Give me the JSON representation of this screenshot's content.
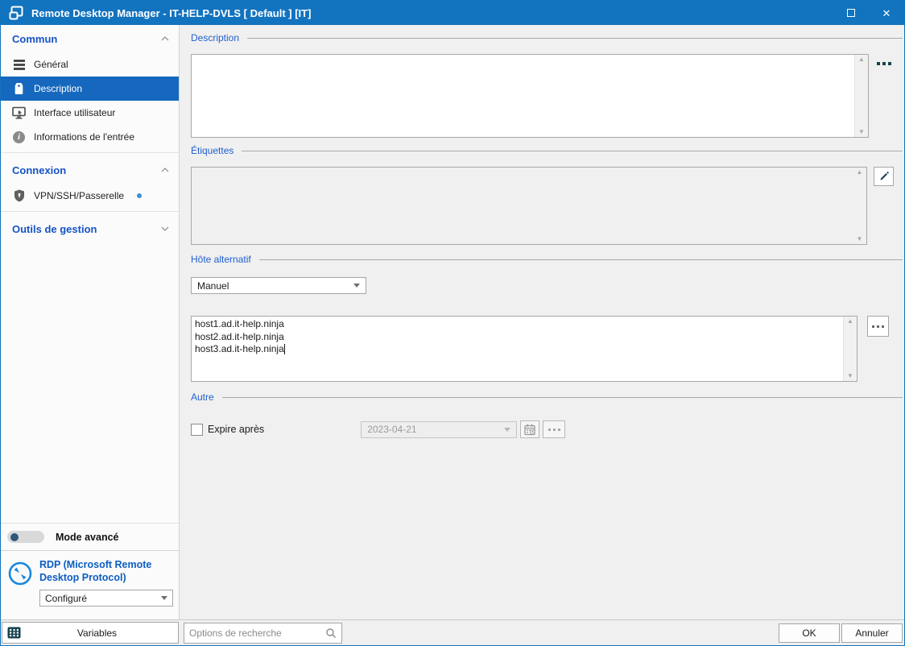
{
  "window": {
    "title": "Remote Desktop Manager - IT-HELP-DVLS [ Default ] [IT]",
    "close_glyph": "✕"
  },
  "sidebar": {
    "sections": [
      {
        "label": "Commun",
        "chevron": "up",
        "items": [
          {
            "label": "Général",
            "icon": "menu-lines-icon"
          },
          {
            "label": "Description",
            "icon": "tag-icon",
            "selected": true
          },
          {
            "label": "Interface utilisateur",
            "icon": "monitor-icon"
          },
          {
            "label": "Informations de l'entrée",
            "icon": "info-icon"
          }
        ]
      },
      {
        "label": "Connexion",
        "chevron": "up",
        "items": [
          {
            "label": "VPN/SSH/Passerelle",
            "icon": "shield-icon",
            "badge_dot": true
          }
        ]
      },
      {
        "label": "Outils de gestion",
        "chevron": "down",
        "items": []
      }
    ],
    "advanced_mode": {
      "label": "Mode avancé",
      "enabled": false
    },
    "protocol": {
      "title": "RDP (Microsoft Remote Desktop Protocol)",
      "status_value": "Configuré",
      "icon": "rdp-connect-icon"
    }
  },
  "main": {
    "groups": {
      "description": {
        "label": "Description",
        "value": ""
      },
      "tags": {
        "label": "Étiquettes",
        "value": ""
      },
      "alternate_host": {
        "label": "Hôte alternatif",
        "mode_value": "Manuel",
        "hosts_value": "host1.ad.it-help.ninja\nhost2.ad.it-help.ninja\nhost3.ad.it-help.ninja"
      },
      "other": {
        "label": "Autre",
        "expire_label": "Expire après",
        "expire_checked": false,
        "expire_date": "2023-04-21"
      }
    }
  },
  "footer": {
    "variables_label": "Variables",
    "search_placeholder": "Options de recherche",
    "ok_label": "OK",
    "cancel_label": "Annuler"
  },
  "colors": {
    "titlebar": "#1273bf",
    "selected_item": "#1568bd",
    "section_header_text": "#1553c6",
    "group_label_text": "#2160cf",
    "accent_icon_teal": "#17424e",
    "rdp_icon_blue": "#1787e0"
  }
}
